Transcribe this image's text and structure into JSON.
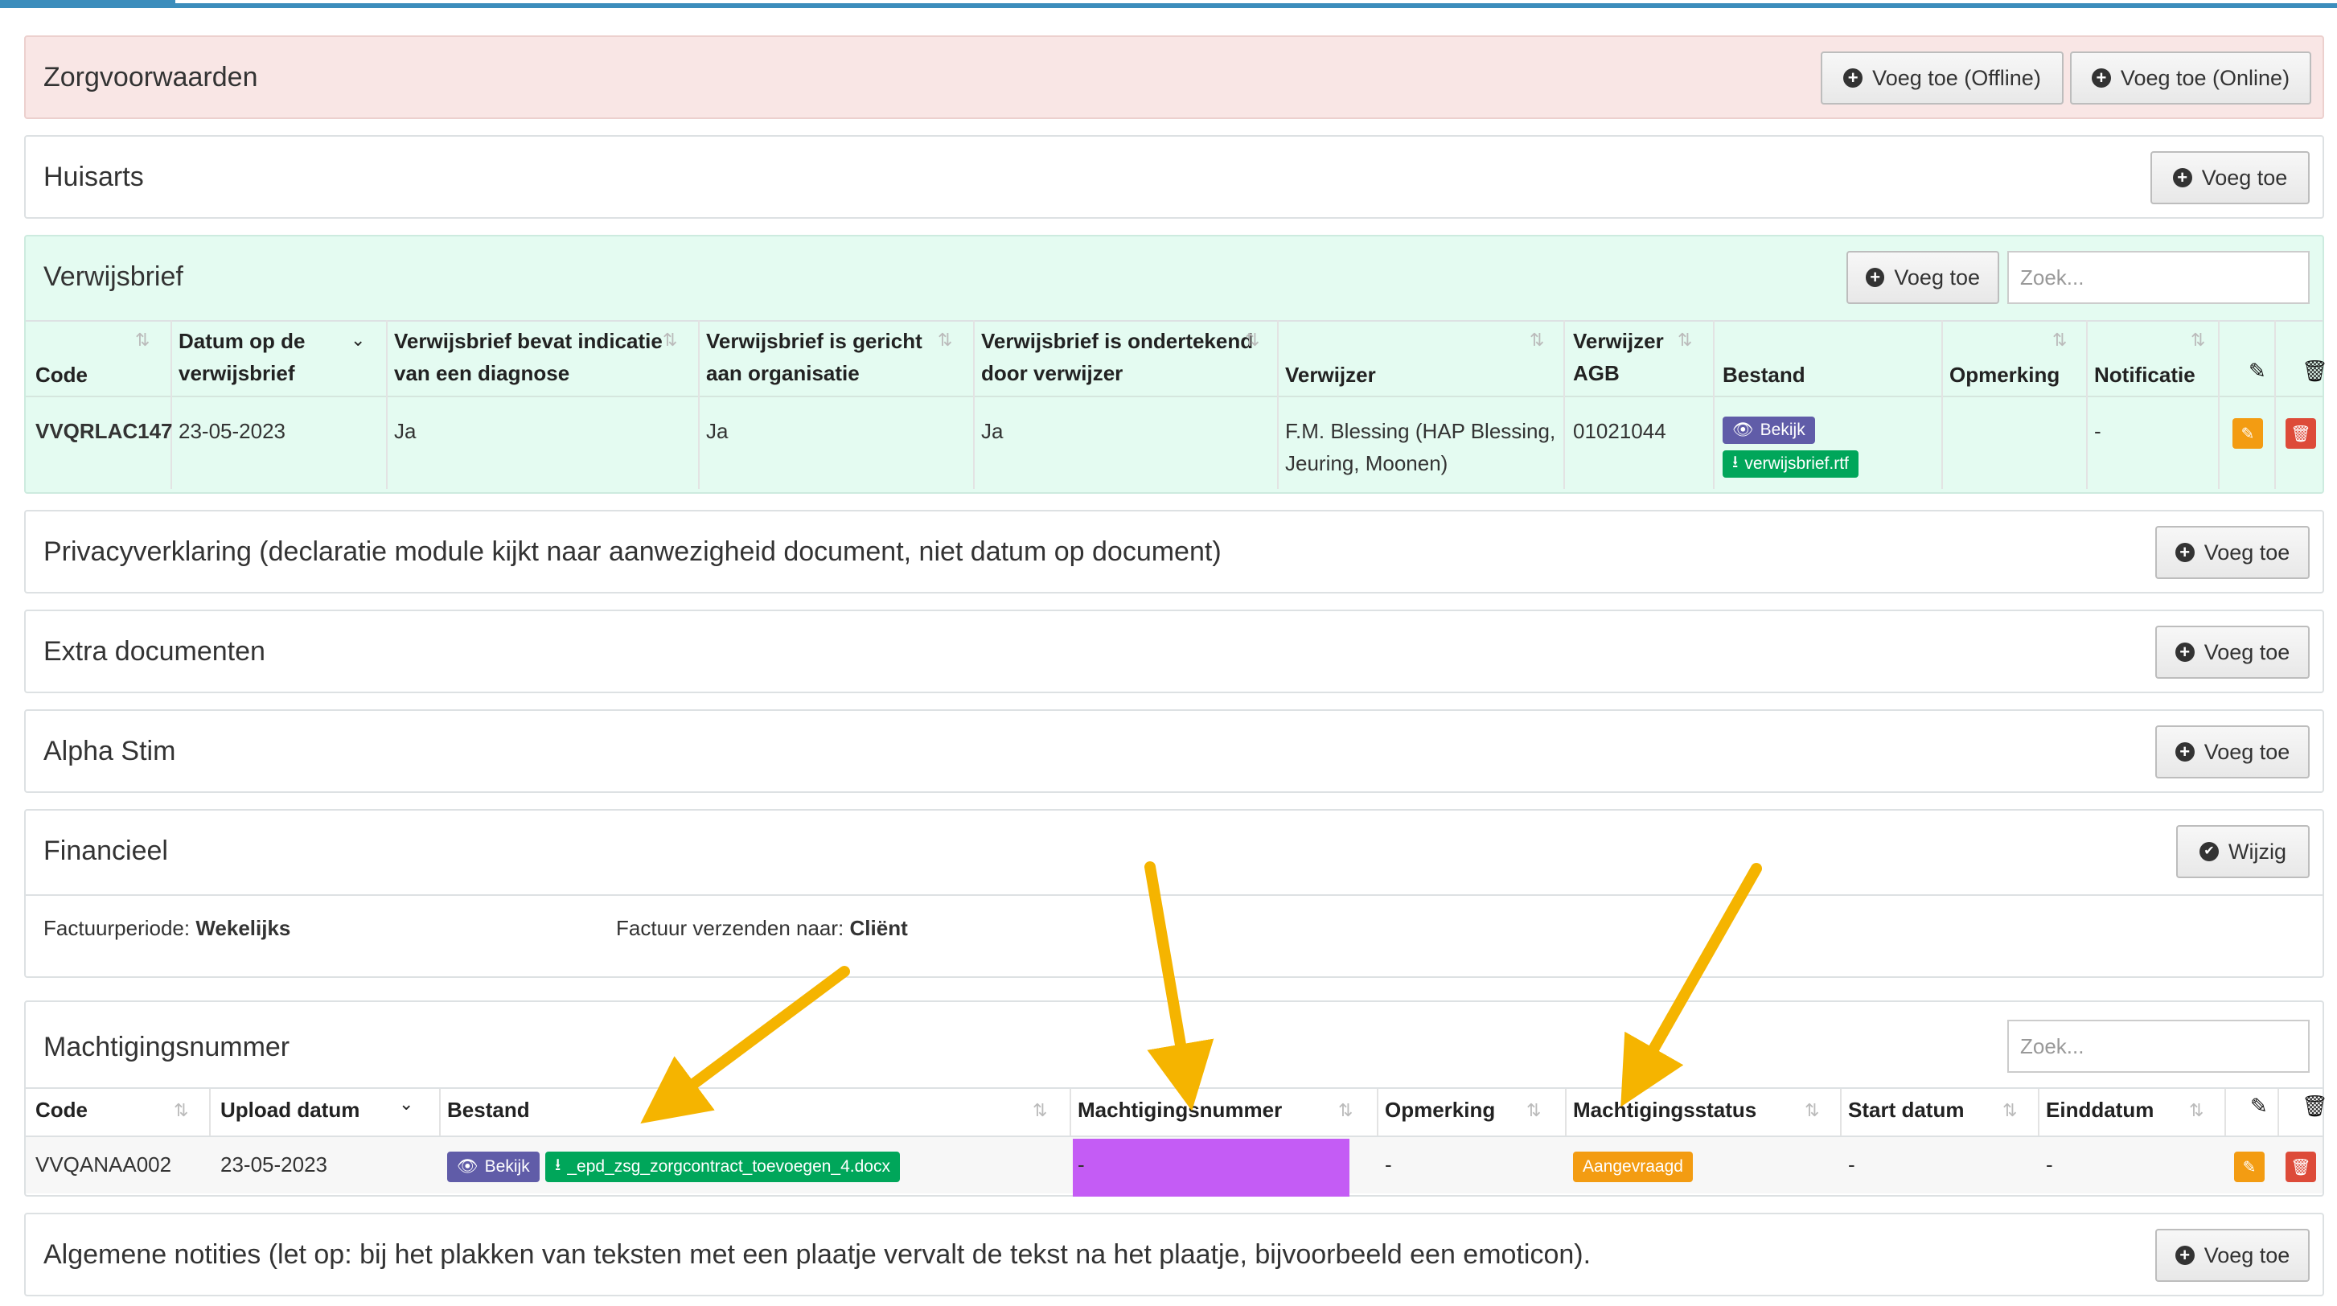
{
  "zorg": {
    "title": "Zorgvoorwaarden",
    "btn_offline": "Voeg toe (Offline)",
    "btn_online": "Voeg toe (Online)"
  },
  "huisarts": {
    "title": "Huisarts",
    "btn": "Voeg toe"
  },
  "verwijsbrief": {
    "title": "Verwijsbrief",
    "btn": "Voeg toe",
    "search_placeholder": "Zoek...",
    "headers": {
      "code": "Code",
      "datum_1": "Datum op de",
      "datum_2": "verwijsbrief",
      "diag_1": "Verwijsbrief bevat indicatie",
      "diag_2": "van een diagnose",
      "org_1": "Verwijsbrief is gericht",
      "org_2": "aan organisatie",
      "ond_1": "Verwijsbrief is ondertekend",
      "ond_2": "door verwijzer",
      "verwijzer": "Verwijzer",
      "agb_1": "Verwijzer",
      "agb_2": "AGB",
      "bestand": "Bestand",
      "opmerking": "Opmerking",
      "notificatie": "Notificatie"
    },
    "row": {
      "code": "VVQRLAC147",
      "datum": "23-05-2023",
      "diag": "Ja",
      "org": "Ja",
      "ond": "Ja",
      "verwijzer_1": "F.M. Blessing (HAP Blessing,",
      "verwijzer_2": "Jeuring, Moonen)",
      "agb": "01021044",
      "bekijk": "Bekijk",
      "file": "verwijsbrief.rtf",
      "opmerking": "",
      "notificatie": "-"
    }
  },
  "privacy": {
    "title": "Privacyverklaring (declaratie module kijkt naar aanwezigheid document, niet datum op document)",
    "btn": "Voeg toe"
  },
  "extra": {
    "title": "Extra documenten",
    "btn": "Voeg toe"
  },
  "alpha": {
    "title": "Alpha Stim",
    "btn": "Voeg toe"
  },
  "financieel": {
    "title": "Financieel",
    "btn": "Wijzig",
    "periode_label": "Factuurperiode:",
    "periode_value": "Wekelijks",
    "naar_label": "Factuur verzenden naar:",
    "naar_value": "Cliënt"
  },
  "machtiging": {
    "title": "Machtigingsnummer",
    "search_placeholder": "Zoek...",
    "headers": {
      "code": "Code",
      "upload": "Upload datum",
      "bestand": "Bestand",
      "nummer": "Machtigingsnummer",
      "opmerking": "Opmerking",
      "status": "Machtigingsstatus",
      "start": "Start datum",
      "eind": "Einddatum"
    },
    "row": {
      "code": "VVQANAA002",
      "upload": "23-05-2023",
      "bekijk": "Bekijk",
      "file": "_epd_zsg_zorgcontract_toevoegen_4.docx",
      "nummer": "-",
      "opmerking": "-",
      "status": "Aangevraagd",
      "start": "-",
      "eind": "-"
    }
  },
  "notities": {
    "title": "Algemene notities (let op: bij het plakken van teksten met een plaatje vervalt de tekst na het plaatje, bijvoorbeeld een emoticon).",
    "btn": "Voeg toe"
  },
  "colors": {
    "accent": "#3c8dbc",
    "annotation_arrow": "#f5b400",
    "highlight": "#c45cf5",
    "label_purple": "#605ca8",
    "label_green": "#00a65a",
    "label_orange": "#f39c12",
    "danger": "#dd4b39"
  },
  "icons": [
    "plus-circle-icon",
    "check-circle-icon",
    "sort-icon",
    "chevron-down-icon",
    "pencil-icon",
    "trash-icon",
    "eye-icon",
    "download-icon"
  ]
}
